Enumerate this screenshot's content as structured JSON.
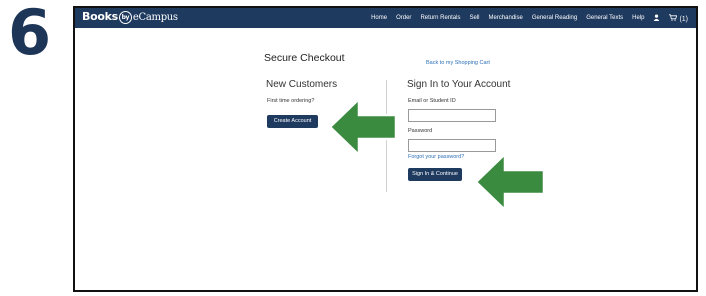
{
  "step_number": "6",
  "header": {
    "brand": {
      "books": "Books",
      "by": "by",
      "ecampus": "eCampus"
    },
    "nav": [
      "Home",
      "Order",
      "Return Rentals",
      "Sell",
      "Merchandise",
      "General Reading",
      "General Texts",
      "Help"
    ],
    "cart_count": "(1)",
    "icons": [
      "user-icon",
      "cart-icon"
    ]
  },
  "checkout": {
    "title": "Secure Checkout",
    "back_link": "Back to my Shopping Cart"
  },
  "new_customers": {
    "heading": "New Customers",
    "prompt": "First time ordering?",
    "button": "Create Account"
  },
  "sign_in": {
    "heading": "Sign In to Your Account",
    "email_label": "Email or Student ID",
    "email_value": "",
    "password_label": "Password",
    "password_value": "",
    "forgot_link": "Forgot your password?",
    "button": "Sign In & Continue"
  },
  "colors": {
    "navbar": "#1f3a5f",
    "button": "#1f3a5f",
    "link": "#2c6fb5",
    "arrow": "#3a8a3f",
    "step_number": "#1d3557"
  }
}
